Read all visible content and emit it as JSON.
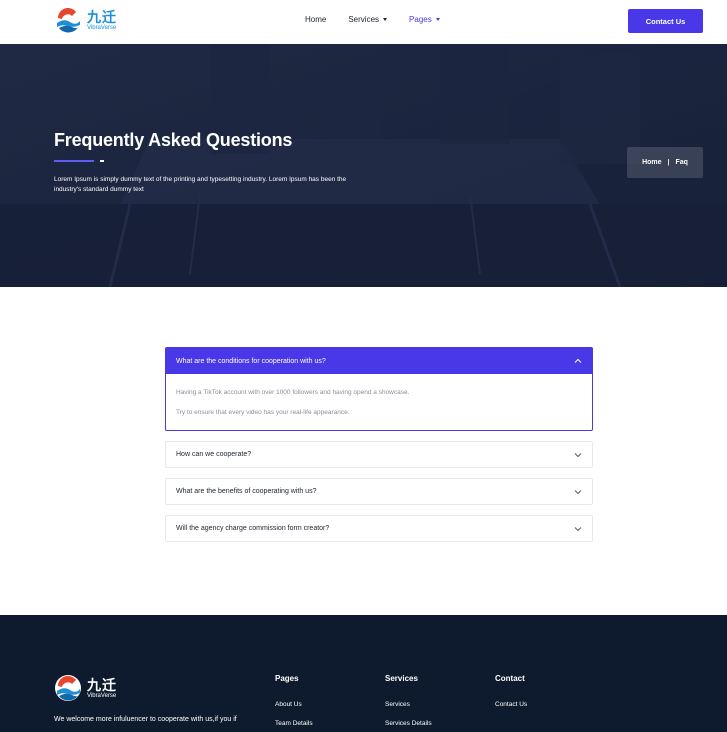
{
  "colors": {
    "accent": "#4838e8",
    "footer_bg": "#0e1b2e",
    "hero_overlay": "#1b2540"
  },
  "header": {
    "logo": {
      "cn": "九迁",
      "en": "VibraVerse"
    },
    "nav": [
      {
        "label": "Home",
        "has_dropdown": false,
        "active": false
      },
      {
        "label": "Services",
        "has_dropdown": true,
        "active": false
      },
      {
        "label": "Pages",
        "has_dropdown": true,
        "active": true
      }
    ],
    "contact_label": "Contact Us"
  },
  "hero": {
    "title": "Frequently Asked Questions",
    "description": "Lorem Ipsum is simply dummy text of the printing and typesetting industry. Lorem Ipsum has been the industry's standard dummy text",
    "breadcrumb": {
      "home": "Home",
      "separator": "|",
      "current": "Faq"
    }
  },
  "faq": {
    "items": [
      {
        "question": "What are the conditions for cooperation with us?",
        "open": true,
        "answer": [
          "Having a TikTok account with over 1000 followers and having opend a showcase.",
          "Try to ensure that every video has your real-life appearance."
        ]
      },
      {
        "question": "How can we cooperate?",
        "open": false
      },
      {
        "question": "What are the benefits of cooperating with us?",
        "open": false
      },
      {
        "question": "Will the agency charge commission form creator?",
        "open": false
      }
    ]
  },
  "footer": {
    "logo": {
      "cn": "九迁",
      "en": "VibraVerse"
    },
    "description": "We welcome more infuluencer to cooperate with us,if you if",
    "columns": [
      {
        "title": "Pages",
        "links": [
          "About Us",
          "Team Details"
        ]
      },
      {
        "title": "Services",
        "links": [
          "Services",
          "Services Details"
        ]
      },
      {
        "title": "Contact",
        "links": [
          "Contact Us"
        ]
      }
    ]
  }
}
